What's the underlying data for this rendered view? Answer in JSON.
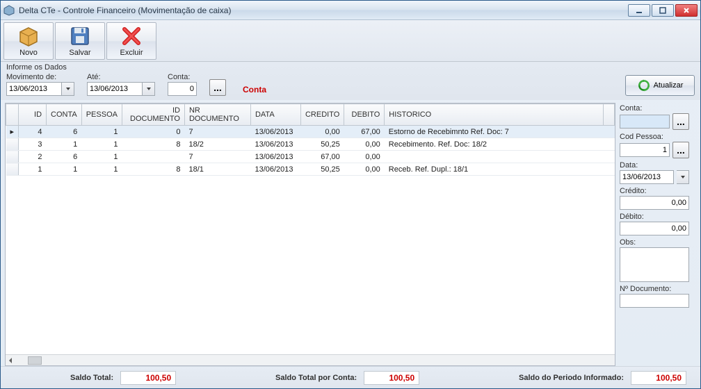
{
  "window": {
    "title": "Delta CTe - Controle Financeiro (Movimentação de caixa)"
  },
  "toolbar": {
    "novo": "Novo",
    "salvar": "Salvar",
    "excluir": "Excluir"
  },
  "filter": {
    "info": "Informe os Dados",
    "movimento_label": "Movimento de:",
    "movimento_value": "13/06/2013",
    "ate_label": "Até:",
    "ate_value": "13/06/2013",
    "conta_label": "Conta:",
    "conta_value": "0",
    "conta_red": "Conta",
    "atualizar": "Atualizar"
  },
  "grid": {
    "headers": {
      "id": "ID",
      "conta": "CONTA",
      "pessoa": "PESSOA",
      "id_doc": "ID DOCUMENTO",
      "nr_doc": "NR DOCUMENTO",
      "data": "DATA",
      "credito": "CREDITO",
      "debito": "DEBITO",
      "historico": "HISTORICO"
    },
    "rows": [
      {
        "id": "4",
        "conta": "6",
        "pessoa": "1",
        "id_doc": "0",
        "nr_doc": "7",
        "data": "13/06/2013",
        "credito": "0,00",
        "debito": "67,00",
        "historico": "Estorno de Recebimnto Ref. Doc: 7"
      },
      {
        "id": "3",
        "conta": "1",
        "pessoa": "1",
        "id_doc": "8",
        "nr_doc": "18/2",
        "data": "13/06/2013",
        "credito": "50,25",
        "debito": "0,00",
        "historico": "Recebimento. Ref. Doc: 18/2"
      },
      {
        "id": "2",
        "conta": "6",
        "pessoa": "1",
        "id_doc": "",
        "nr_doc": "7",
        "data": "13/06/2013",
        "credito": "67,00",
        "debito": "0,00",
        "historico": ""
      },
      {
        "id": "1",
        "conta": "1",
        "pessoa": "1",
        "id_doc": "8",
        "nr_doc": "18/1",
        "data": "13/06/2013",
        "credito": "50,25",
        "debito": "0,00",
        "historico": "Receb. Ref. Dupl.: 18/1"
      }
    ]
  },
  "side": {
    "conta_label": "Conta:",
    "conta_value": "",
    "cod_pessoa_label": "Cod Pessoa:",
    "cod_pessoa_value": "1",
    "data_label": "Data:",
    "data_value": "13/06/2013",
    "credito_label": "Crédito:",
    "credito_value": "0,00",
    "debito_label": "Débito:",
    "debito_value": "0,00",
    "obs_label": "Obs:",
    "obs_value": "",
    "nr_doc_label": "Nº Documento:",
    "nr_doc_value": ""
  },
  "footer": {
    "saldo_total_label": "Saldo Total:",
    "saldo_total_value": "100,50",
    "saldo_conta_label": "Saldo Total por Conta:",
    "saldo_conta_value": "100,50",
    "saldo_periodo_label": "Saldo do Periodo Informado:",
    "saldo_periodo_value": "100,50"
  }
}
